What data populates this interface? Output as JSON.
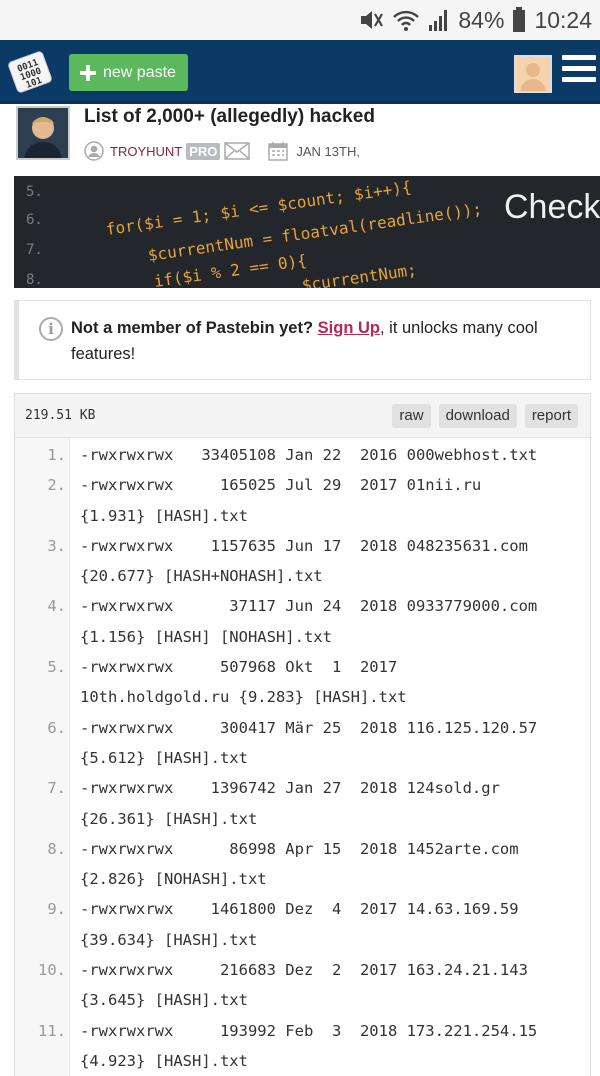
{
  "status": {
    "battery": "84%",
    "time": "10:24"
  },
  "header": {
    "new_paste_label": "new paste",
    "logo_text": "0011 1000 101"
  },
  "paste": {
    "title": "List of 2,000+ (allegedly) hacked",
    "user": "TROYHUNT",
    "badge": "PRO",
    "date": "JAN 13TH,"
  },
  "banner": {
    "line_numbers": [
      "5.",
      "6.",
      "7.",
      "8."
    ],
    "code_line1": "for($i = 1; $i <= $count; $i++){",
    "code_line2": "$currentNum = floatval(readline());",
    "code_line3": "if($i % 2 == 0){",
    "code_line4": "$currentNum;",
    "heading": "Check"
  },
  "notice": {
    "bold": "Not a member of Pastebin yet?",
    "link": "Sign Up",
    "rest": ", it unlocks many cool features!"
  },
  "code": {
    "size": "219.51 KB",
    "buttons": {
      "raw": "raw",
      "download": "download",
      "report": "report"
    },
    "lines": [
      {
        "n": "1.",
        "text": [
          "-rwxrwxrwx   33405108 Jan 22  2016 000webhost.txt"
        ]
      },
      {
        "n": "2.",
        "text": [
          "-rwxrwxrwx     165025 Jul 29  2017 01nii.ru",
          "{1.931} [HASH].txt"
        ]
      },
      {
        "n": "3.",
        "text": [
          "-rwxrwxrwx    1157635 Jun 17  2018 048235631.com",
          "{20.677} [HASH+NOHASH].txt"
        ]
      },
      {
        "n": "4.",
        "text": [
          "-rwxrwxrwx      37117 Jun 24  2018 0933779000.com",
          "{1.156} [HASH] [NOHASH].txt"
        ]
      },
      {
        "n": "5.",
        "text": [
          "-rwxrwxrwx     507968 Okt  1  2017",
          "10th.holdgold.ru {9.283} [HASH].txt"
        ]
      },
      {
        "n": "6.",
        "text": [
          "-rwxrwxrwx     300417 Mär 25  2018 116.125.120.57",
          "{5.612} [HASH].txt"
        ]
      },
      {
        "n": "7.",
        "text": [
          "-rwxrwxrwx    1396742 Jan 27  2018 124sold.gr",
          "{26.361} [HASH].txt"
        ]
      },
      {
        "n": "8.",
        "text": [
          "-rwxrwxrwx      86998 Apr 15  2018 1452arte.com",
          "{2.826} [NOHASH].txt"
        ]
      },
      {
        "n": "9.",
        "text": [
          "-rwxrwxrwx    1461800 Dez  4  2017 14.63.169.59",
          "{39.634} [HASH].txt"
        ]
      },
      {
        "n": "10.",
        "text": [
          "-rwxrwxrwx     216683 Dez  2  2017 163.24.21.143",
          "{3.645} [HASH].txt"
        ]
      },
      {
        "n": "11.",
        "text": [
          "-rwxrwxrwx     193992 Feb  3  2018 173.221.254.15",
          "{4.923} [HASH].txt"
        ]
      }
    ]
  },
  "colors": {
    "header": "#0b3a66",
    "new_paste": "#5cb85c",
    "link": "#b5295a"
  }
}
